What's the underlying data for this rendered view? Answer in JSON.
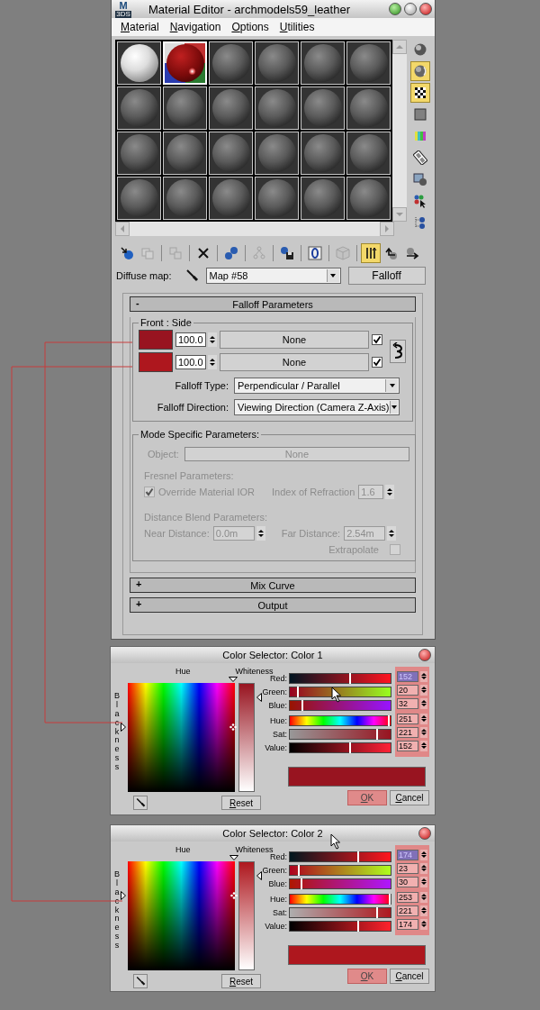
{
  "window": {
    "logo": "M",
    "logo_sub": "3DS",
    "title": "Material Editor - archmodels59_leather"
  },
  "menu": [
    "Material",
    "Navigation",
    "Options",
    "Utilities"
  ],
  "slots": [
    {
      "kind": "white",
      "selected": false
    },
    {
      "kind": "red",
      "selected": true
    },
    {
      "kind": "gray",
      "selected": false
    },
    {
      "kind": "gray",
      "selected": false
    },
    {
      "kind": "gray",
      "selected": false
    },
    {
      "kind": "gray",
      "selected": false
    },
    {
      "kind": "gray",
      "selected": false
    },
    {
      "kind": "gray",
      "selected": false
    },
    {
      "kind": "gray",
      "selected": false
    },
    {
      "kind": "gray",
      "selected": false
    },
    {
      "kind": "gray",
      "selected": false
    },
    {
      "kind": "gray",
      "selected": false
    },
    {
      "kind": "gray",
      "selected": false
    },
    {
      "kind": "gray",
      "selected": false
    },
    {
      "kind": "gray",
      "selected": false
    },
    {
      "kind": "gray",
      "selected": false
    },
    {
      "kind": "gray",
      "selected": false
    },
    {
      "kind": "gray",
      "selected": false
    },
    {
      "kind": "gray",
      "selected": false
    },
    {
      "kind": "gray",
      "selected": false
    },
    {
      "kind": "gray",
      "selected": false
    },
    {
      "kind": "gray",
      "selected": false
    },
    {
      "kind": "gray",
      "selected": false
    },
    {
      "kind": "gray",
      "selected": false
    }
  ],
  "side_tools": [
    {
      "kind": "sphere",
      "active": false
    },
    {
      "kind": "backlit-sphere",
      "active": true
    },
    {
      "kind": "checker",
      "active": true
    },
    {
      "kind": "square",
      "active": false
    },
    {
      "kind": "color-bars",
      "active": false
    },
    {
      "kind": "film-strip",
      "active": false
    },
    {
      "kind": "slot-sphere",
      "active": false
    },
    {
      "kind": "balls-pointer",
      "active": false
    },
    {
      "kind": "ball-tree",
      "active": false
    }
  ],
  "toolbar_groups": [
    {
      "tools": [
        {
          "kind": "ball-arrow",
          "active": false,
          "disabled": false
        },
        {
          "kind": "sheets",
          "active": false,
          "disabled": true
        }
      ]
    },
    {
      "tools": [
        {
          "kind": "boxes",
          "active": false,
          "disabled": true
        }
      ]
    },
    {
      "tools": [
        {
          "kind": "cross",
          "active": false,
          "disabled": false
        }
      ]
    },
    {
      "tools": [
        {
          "kind": "linked-balls",
          "active": false,
          "disabled": false
        }
      ]
    },
    {
      "tools": [
        {
          "kind": "node-tree",
          "active": false,
          "disabled": true
        }
      ]
    },
    {
      "tools": [
        {
          "kind": "ball-disk",
          "active": false,
          "disabled": false
        }
      ]
    },
    {
      "tools": [
        {
          "kind": "oval-box",
          "active": false,
          "disabled": false
        }
      ]
    },
    {
      "tools": [
        {
          "kind": "cube",
          "active": false,
          "disabled": true
        }
      ]
    },
    {
      "tools": [
        {
          "kind": "bars-up",
          "active": true,
          "disabled": false
        },
        {
          "kind": "up-arrow",
          "active": false,
          "disabled": false
        },
        {
          "kind": "right-arrow",
          "active": false,
          "disabled": false
        }
      ]
    }
  ],
  "diffuse": {
    "label": "Diffuse map:",
    "value": "Map #58",
    "type_button": "Falloff"
  },
  "falloff_rollout": {
    "sign": "-",
    "title": "Falloff Parameters"
  },
  "front_side": {
    "title": "Front : Side",
    "rows": [
      {
        "color": "#981420",
        "amount": "100.0",
        "map": "None",
        "checked": true
      },
      {
        "color": "#ae171e",
        "amount": "100.0",
        "map": "None",
        "checked": true
      }
    ]
  },
  "falloff_type": {
    "label": "Falloff Type:",
    "value": "Perpendicular / Parallel"
  },
  "falloff_direction": {
    "label": "Falloff Direction:",
    "value": "Viewing Direction (Camera Z-Axis)"
  },
  "mode_specific": {
    "title": "Mode Specific Parameters:",
    "disabled": true,
    "object_label": "Object:",
    "object_value": "None",
    "fresnel_title": "Fresnel Parameters:",
    "override": {
      "label": "Override Material IOR",
      "checked": true
    },
    "ior": {
      "label": "Index of Refraction",
      "value": "1.6"
    },
    "distance_title": "Distance Blend Parameters:",
    "near": {
      "label": "Near Distance:",
      "value": "0.0m"
    },
    "far": {
      "label": "Far Distance:",
      "value": "2.54m"
    },
    "extrapolate": {
      "label": "Extrapolate",
      "checked": false
    }
  },
  "collapsed_rollouts": [
    {
      "sign": "+",
      "title": "Mix Curve"
    },
    {
      "sign": "+",
      "title": "Output"
    }
  ],
  "dialogs": [
    {
      "title": "Color Selector: Color 1",
      "hue_label": "Hue",
      "whiteness_label": "Whiteness",
      "blackness_label": "Blackness",
      "values_highlighted": true,
      "ok_highlighted": true,
      "reset": "Reset",
      "ok": "OK",
      "cancel": "Cancel",
      "channels": [
        {
          "kind": "red",
          "name": "Red:",
          "value": "152",
          "level": 0.596,
          "text_selected": true
        },
        {
          "kind": "green",
          "name": "Green:",
          "value": "20",
          "level": 0.078,
          "text_selected": false
        },
        {
          "kind": "blue",
          "name": "Blue:",
          "value": "32",
          "level": 0.125,
          "text_selected": false
        },
        {
          "kind": "hue",
          "name": "Hue:",
          "value": "251",
          "level": 0.984,
          "text_selected": false
        },
        {
          "kind": "sat",
          "name": "Sat:",
          "value": "221",
          "level": 0.867,
          "text_selected": false
        },
        {
          "kind": "value",
          "name": "Value:",
          "value": "152",
          "level": 0.596,
          "text_selected": false
        }
      ]
    },
    {
      "title": "Color Selector: Color 2",
      "hue_label": "Hue",
      "whiteness_label": "Whiteness",
      "blackness_label": "Blackness",
      "values_highlighted": true,
      "ok_highlighted": true,
      "reset": "Reset",
      "ok": "OK",
      "cancel": "Cancel",
      "channels": [
        {
          "kind": "red",
          "name": "Red:",
          "value": "174",
          "level": 0.682,
          "text_selected": true
        },
        {
          "kind": "green",
          "name": "Green:",
          "value": "23",
          "level": 0.09,
          "text_selected": false
        },
        {
          "kind": "blue",
          "name": "Blue:",
          "value": "30",
          "level": 0.118,
          "text_selected": false
        },
        {
          "kind": "hue",
          "name": "Hue:",
          "value": "253",
          "level": 0.992,
          "text_selected": false
        },
        {
          "kind": "sat",
          "name": "Sat:",
          "value": "221",
          "level": 0.867,
          "text_selected": false
        },
        {
          "kind": "value",
          "name": "Value:",
          "value": "174",
          "level": 0.682,
          "text_selected": false
        }
      ]
    }
  ]
}
